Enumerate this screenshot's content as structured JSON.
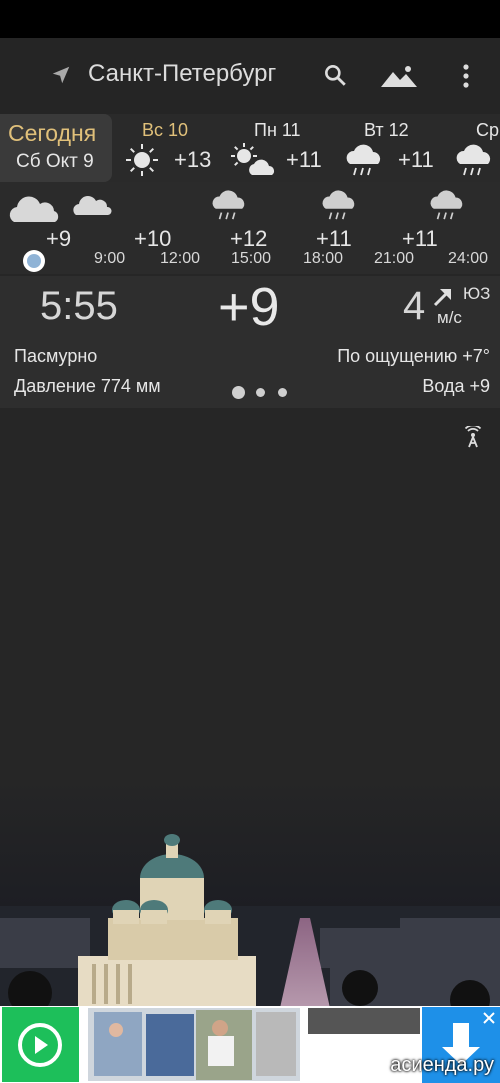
{
  "header": {
    "city": "Санкт-Петербург",
    "icons": [
      "location-arrow-icon",
      "search-icon",
      "photo-landscape-icon",
      "more-vert-icon"
    ]
  },
  "days": {
    "today": {
      "label": "Сегодня",
      "date": "Сб Окт 9"
    },
    "items": [
      {
        "name": "Вс 10",
        "temp": "+13",
        "icon": "sun-icon",
        "color": "#e0c07a"
      },
      {
        "name": "Пн 11",
        "temp": "+11",
        "icon": "sun-cloud-icon",
        "color": "#e6e6e6"
      },
      {
        "name": "Вт 12",
        "temp": "+11",
        "icon": "cloud-rain-icon",
        "color": "#e6e6e6"
      },
      {
        "name": "Ср",
        "temp": "",
        "icon": "cloud-rain-icon",
        "color": "#e6e6e6"
      }
    ]
  },
  "hourly": [
    {
      "temp": "+9",
      "time": "",
      "icon": "cloud-icon"
    },
    {
      "temp": "+10",
      "time": "9:00",
      "icon": "cloud-icon"
    },
    {
      "temp": "+12",
      "time": "12:00",
      "icon": "none"
    },
    {
      "temp": "+11",
      "time": "15:00",
      "icon": "cloud-rain-icon"
    },
    {
      "temp": "+11",
      "time": "18:00",
      "icon": "cloud-rain-icon"
    },
    {
      "temp": "",
      "time": "21:00",
      "icon": "cloud-rain-icon"
    },
    {
      "temp": "",
      "time": "24:00",
      "icon": "none"
    }
  ],
  "current": {
    "time": "5:55",
    "temp": "+9",
    "wind_speed": "4",
    "wind_dir": "ЮЗ",
    "wind_unit": "м/с",
    "condition": "Пасмурно",
    "feels_like": "По ощущению +7°",
    "pressure": "Давление 774 мм",
    "water": "Вода +9"
  },
  "ad": {
    "watermark": "асиенда.ру"
  },
  "colors": {
    "accent_gold": "#e0c07a",
    "background": "#262626",
    "ad_green": "#1dbf5a",
    "ad_blue": "#1e90e8"
  }
}
